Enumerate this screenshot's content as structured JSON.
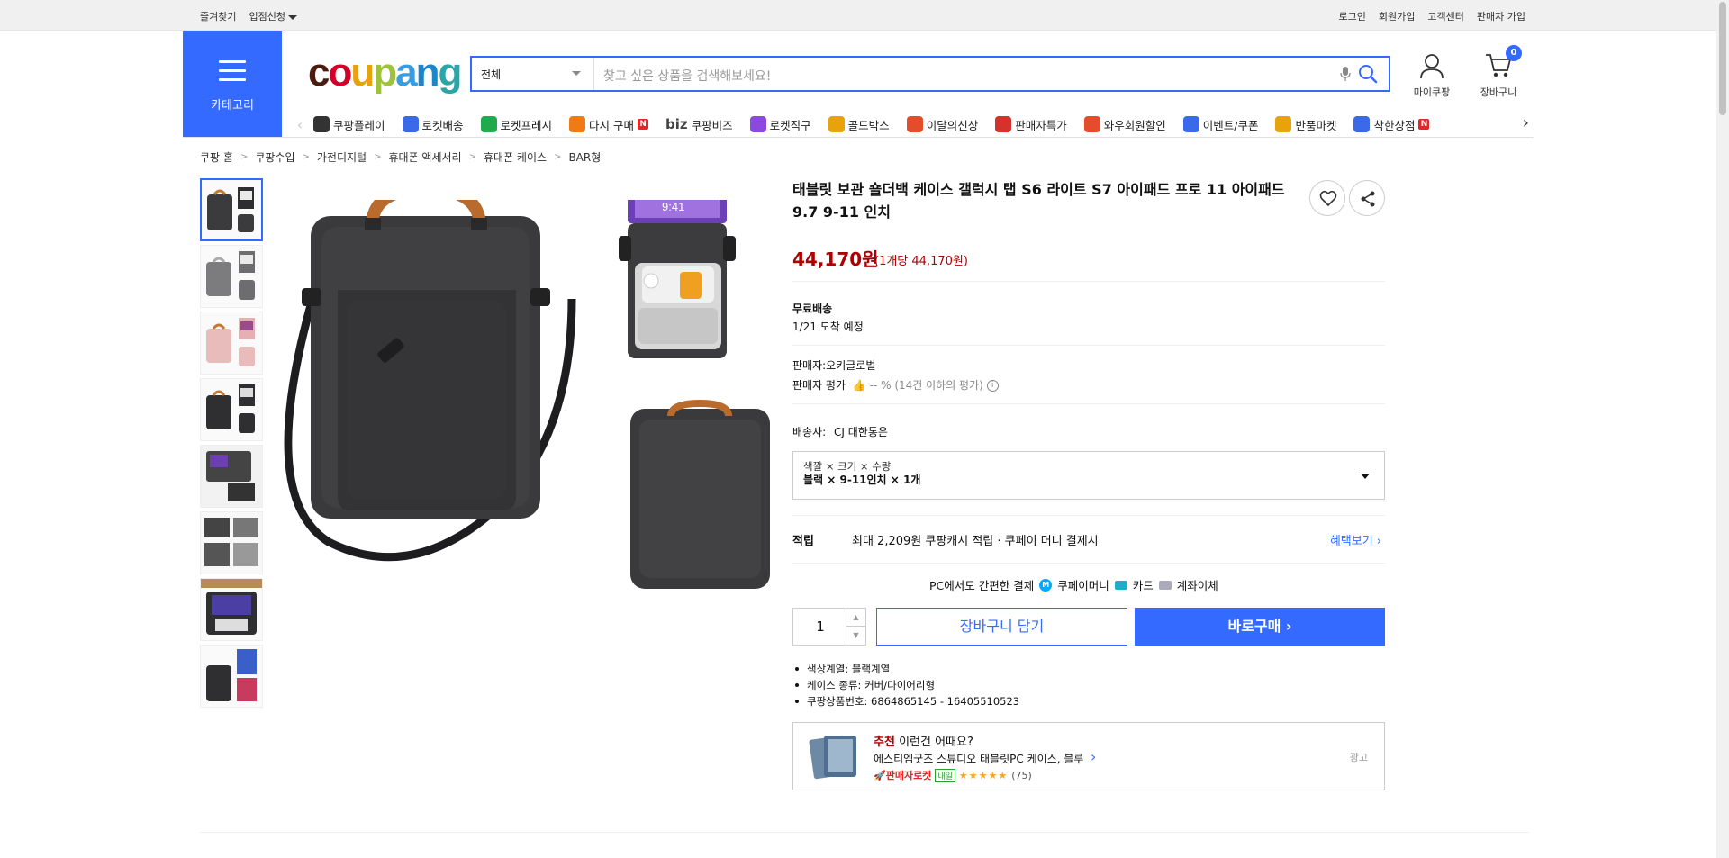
{
  "topbar": {
    "left": [
      "즐겨찾기",
      "입점신청"
    ],
    "right": [
      "로그인",
      "회원가입",
      "고객센터",
      "판매자 가입"
    ]
  },
  "header": {
    "category_label": "카테고리",
    "logo": {
      "letters": [
        "c",
        "o",
        "u",
        "p",
        "a",
        "n",
        "g"
      ],
      "colors": [
        "#4b1b0f",
        "#d4002a",
        "#e8a20c",
        "#9ec23b",
        "#3a9de0",
        "#1c86c8",
        "#2aa5a8"
      ]
    },
    "search": {
      "category": "전체",
      "placeholder": "찾고 싶은 상품을 검색해보세요!"
    },
    "my_coupang": "마이쿠팡",
    "cart_label": "장바구니",
    "cart_count": "0"
  },
  "quick_menu": [
    {
      "label": "쿠팡플레이",
      "icon": "coupang-play-icon",
      "color": "#333"
    },
    {
      "label": "로켓배송",
      "icon": "rocket-icon",
      "color": "#3b6ae8"
    },
    {
      "label": "로켓프레시",
      "icon": "rocket-fresh-icon",
      "color": "#1faa4c"
    },
    {
      "label": "다시 구매",
      "icon": "rebuy-icon",
      "color": "#f07b14",
      "badge": "N"
    },
    {
      "label": "쿠팡비즈",
      "prefix": "biz",
      "icon": "biz-icon",
      "color": "#444"
    },
    {
      "label": "로켓직구",
      "icon": "global-icon",
      "color": "#8c49e0"
    },
    {
      "label": "골드박스",
      "icon": "gold-box-icon",
      "color": "#e8a20c"
    },
    {
      "label": "이달의신상",
      "icon": "new-icon",
      "color": "#e54c2b"
    },
    {
      "label": "판매자특가",
      "icon": "seller-deal-icon",
      "color": "#d4322a"
    },
    {
      "label": "와우회원할인",
      "icon": "wow-icon",
      "color": "#e54c2b"
    },
    {
      "label": "이벤트/쿠폰",
      "icon": "event-icon",
      "color": "#3b6ae8"
    },
    {
      "label": "반품마켓",
      "icon": "return-market-icon",
      "color": "#e8a20c"
    },
    {
      "label": "착한상점",
      "icon": "good-shop-icon",
      "color": "#3b6ae8",
      "badge": "N"
    }
  ],
  "breadcrumb": [
    "쿠팡 홈",
    "쿠팡수입",
    "가전디지털",
    "휴대폰 액세서리",
    "휴대폰 케이스",
    "BAR형"
  ],
  "product": {
    "title": "태블릿 보관 숄더백 케이스 갤럭시 탭 S6 라이트 S7 아이패드 프로 11 아이패드 9.7 9-11 인치",
    "price": "44,170원",
    "unit_price": "(1개당 44,170원)",
    "shipping": "무료배송",
    "arrival": "1/21 도착 예정",
    "seller": "판매자:오키글로벌",
    "seller_rating_label": "판매자 평가",
    "seller_rating_value": "-- % (14건 이하의 평가)",
    "carrier_label": "배송사:",
    "carrier": "CJ 대한통운",
    "option_label": "색깔 × 크기 × 수량",
    "option_value": "블랙 × 9-11인치 × 1개",
    "reward_label": "적립",
    "reward_prefix": "최대 2,209원",
    "reward_link": "쿠팡캐시 적립",
    "reward_suffix": "· 쿠페이 머니 결제시",
    "reward_more": "혜택보기",
    "pay_title": "PC에서도 간편한 결제",
    "pay_methods": [
      "쿠페이머니",
      "카드",
      "계좌이체"
    ],
    "quantity": "1",
    "add_cart": "장바구니 담기",
    "buy_now": "바로구매",
    "attributes": [
      "색상계열: 블랙계열",
      "케이스 종류: 커버/다이어리형",
      "쿠팡상품번호: 6864865145 - 16405510523"
    ]
  },
  "recommend": {
    "highlight": "추천",
    "heading": "이런건 어때요?",
    "name": "에스티엠굿즈 스튜디오 태블릿PC 케이스, 블루",
    "tag": "판매자로켓",
    "tomorrow": "내일",
    "stars": "★★★★★",
    "count": "(75)",
    "ad": "광고"
  }
}
